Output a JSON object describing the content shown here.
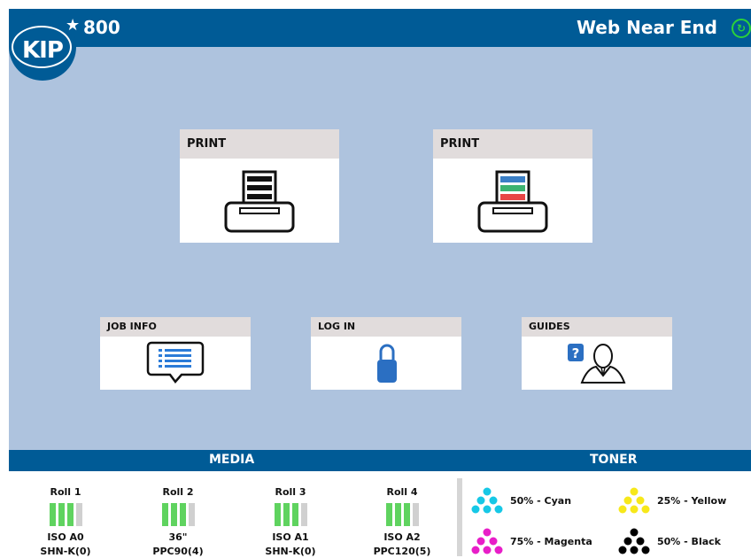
{
  "header": {
    "model": "800",
    "logo_text": "KIP",
    "status": "Web Near End"
  },
  "colors": {
    "header_blue": "#005b96",
    "main_bg": "#aec3de",
    "tile_header": "#e1dcdc",
    "status_underline": "#e8141c",
    "media_full": "#5fd35f",
    "media_empty": "#d0d0d0",
    "cyan": "#16c8e6",
    "magenta": "#e81ec8",
    "yellow": "#f7e81a",
    "black": "#000000"
  },
  "tiles": {
    "print_1": {
      "label": "PRINT",
      "icon": "printer-mono-icon"
    },
    "print_2": {
      "label": "PRINT",
      "icon": "printer-color-icon"
    },
    "job_info": {
      "label": "JOB INFO",
      "icon": "message-list-icon"
    },
    "log_in": {
      "label": "LOG IN",
      "icon": "lock-icon"
    },
    "guides": {
      "label": "GUIDES",
      "icon": "help-person-icon"
    }
  },
  "footer": {
    "media_label": "MEDIA",
    "toner_label": "TONER"
  },
  "media": [
    {
      "name": "Roll 1",
      "size": "ISO A0",
      "type": "SHN-K(0)",
      "level_bars": 3,
      "total_bars": 4
    },
    {
      "name": "Roll 2",
      "size": "36\"",
      "type": "PPC90(4)",
      "level_bars": 3,
      "total_bars": 4
    },
    {
      "name": "Roll 3",
      "size": "ISO A1",
      "type": "SHN-K(0)",
      "level_bars": 3,
      "total_bars": 4
    },
    {
      "name": "Roll 4",
      "size": "ISO A2",
      "type": "PPC120(5)",
      "level_bars": 3,
      "total_bars": 4
    }
  ],
  "toner": [
    {
      "label": "50% - Cyan",
      "color": "#16c8e6",
      "percent": 50
    },
    {
      "label": "25% - Yellow",
      "color": "#f7e81a",
      "percent": 25
    },
    {
      "label": "75% - Magenta",
      "color": "#e81ec8",
      "percent": 75
    },
    {
      "label": "50% - Black",
      "color": "#000000",
      "percent": 50
    }
  ]
}
